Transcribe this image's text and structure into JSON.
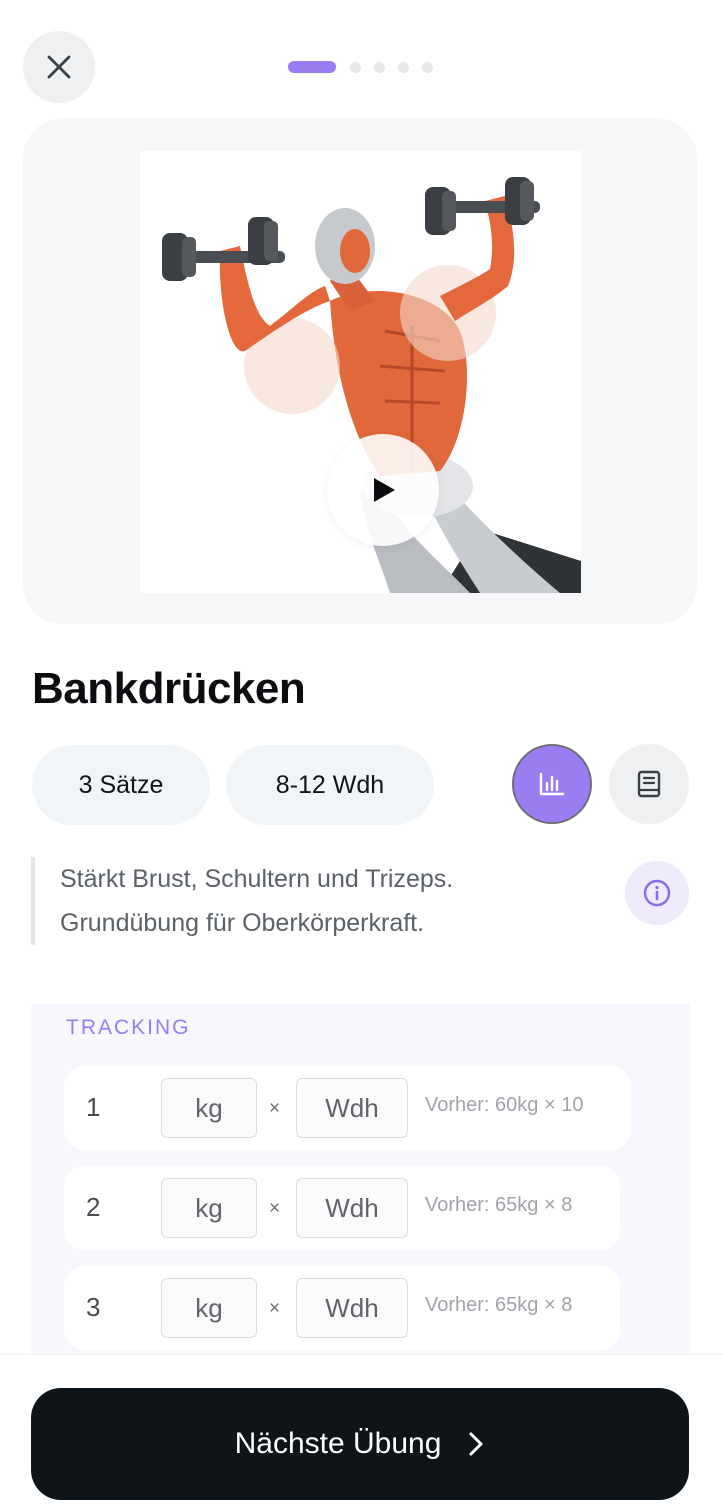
{
  "header": {
    "close_icon": "close-icon",
    "progress": {
      "total_steps": 5,
      "current_step": 1
    }
  },
  "media": {
    "image_alt": "Bankdrücken illustration",
    "play_icon": "play-icon"
  },
  "exercise": {
    "title": "Bankdrücken",
    "sets_label": "3 Sätze",
    "reps_label": "8-12 Wdh",
    "stats_icon": "bar-chart-icon",
    "notes_icon": "notebook-icon",
    "description_line1": "Stärkt Brust, Schultern und Trizeps.",
    "description_line2": "Grundübung für Oberkörperkraft.",
    "info_icon": "info-icon"
  },
  "tracking": {
    "label": "TRACKING",
    "times_symbol": "×",
    "rows": [
      {
        "number": "1",
        "kg_placeholder": "kg",
        "reps_placeholder": "Wdh",
        "previous": "Vorher: 60kg × 10"
      },
      {
        "number": "2",
        "kg_placeholder": "kg",
        "reps_placeholder": "Wdh",
        "previous": "Vorher: 65kg × 8"
      },
      {
        "number": "3",
        "kg_placeholder": "kg",
        "reps_placeholder": "Wdh",
        "previous": "Vorher: 65kg × 8"
      }
    ]
  },
  "footer": {
    "next_label": "Nächste Übung",
    "next_icon": "chevron-right-icon"
  },
  "colors": {
    "accent": "#9a7cf0",
    "primary_button": "#0f1419",
    "muscle": "#e4683c"
  }
}
